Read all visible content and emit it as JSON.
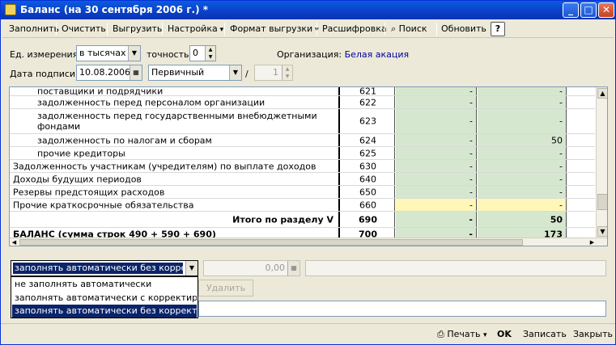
{
  "window": {
    "title": "Баланс (на 30 сентября 2006 г.) *",
    "minimize": "_",
    "maximize": "□",
    "close": "✕"
  },
  "toolbar": {
    "fill": "Заполнить",
    "clear": "Очистить",
    "export": "Выгрузить",
    "settings": "Настройка",
    "export_format": "Формат выгрузки",
    "breakdown": "Расшифровка",
    "search": "Поиск",
    "refresh": "Обновить",
    "help": "?"
  },
  "params": {
    "unit_label": "Ед. измерения:",
    "unit_value": "в тысячах р",
    "precision_label": "точность:",
    "precision_value": "0",
    "org_label": "Организация:",
    "org_value": "Белая акация",
    "sign_date_label": "Дата подписи:",
    "sign_date_value": "10.08.2006",
    "report_kind": "Первичный",
    "slash": "/",
    "version_value": "1"
  },
  "table": {
    "rows": [
      {
        "name": "поставщики и подрядчики",
        "code": "621",
        "v1": "-",
        "v2": "-",
        "indent": true
      },
      {
        "name": "задолженность перед персоналом организации",
        "code": "622",
        "v1": "-",
        "v2": "-",
        "indent": true
      },
      {
        "name": "задолженность перед государственными внебюджетными фондами",
        "code": "623",
        "v1": "-",
        "v2": "-",
        "indent": true
      },
      {
        "name": "задолженность по налогам и сборам",
        "code": "624",
        "v1": "-",
        "v2": "50",
        "indent": true
      },
      {
        "name": "прочие кредиторы",
        "code": "625",
        "v1": "-",
        "v2": "-",
        "indent": true
      },
      {
        "name": "Задолженность участникам (учредителям) по выплате доходов",
        "code": "630",
        "v1": "-",
        "v2": "-",
        "indent": false
      },
      {
        "name": "Доходы будущих периодов",
        "code": "640",
        "v1": "-",
        "v2": "-",
        "indent": false
      },
      {
        "name": "Резервы предстоящих расходов",
        "code": "650",
        "v1": "-",
        "v2": "-",
        "indent": false
      },
      {
        "name": "Прочие краткосрочные обязательства",
        "code": "660",
        "v1": "-",
        "v2": "-",
        "indent": false
      },
      {
        "name": "Итого по разделу V",
        "code": "690",
        "v1": "-",
        "v2": "50",
        "indent": false
      },
      {
        "name": "БАЛАНС (сумма строк 490 + 590 + 690)",
        "code": "700",
        "v1": "-",
        "v2": "173",
        "indent": false
      }
    ]
  },
  "fill_mode": {
    "selected": "заполнять автоматически без корректиро",
    "options": [
      "не заполнять автоматически",
      "заполнять автоматически с корректировк...",
      "заполнять автоматически без корректиро..."
    ]
  },
  "amount": {
    "value": "0,00"
  },
  "delete_button": "Удалить",
  "footer": {
    "print": "Печать",
    "ok": "OK",
    "save": "Записать",
    "close": "Закрыть"
  }
}
